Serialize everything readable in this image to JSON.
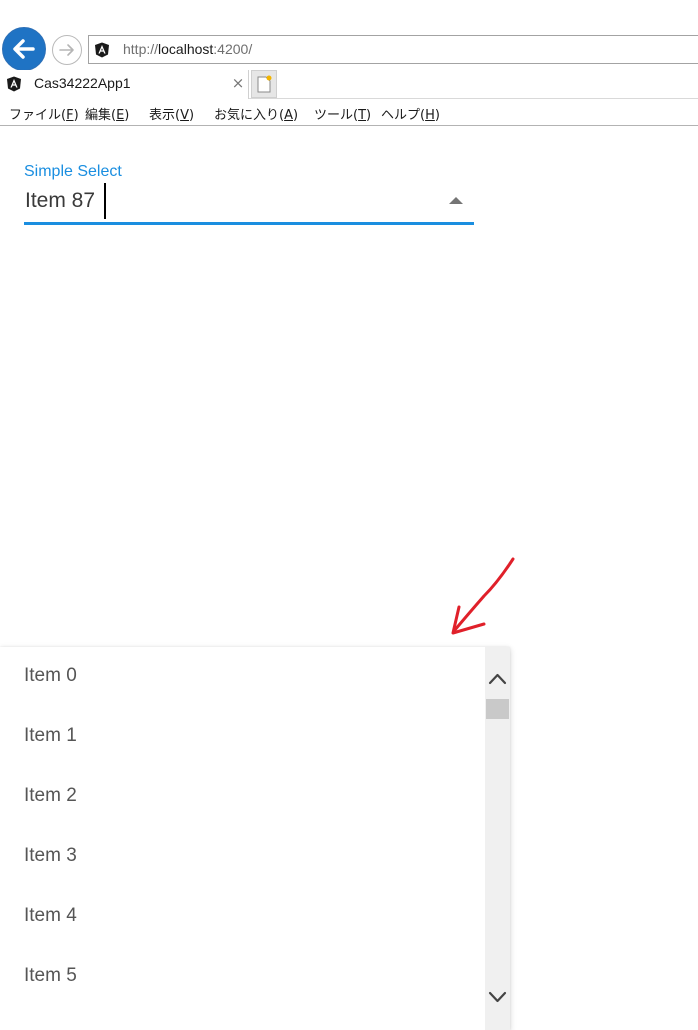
{
  "browser": {
    "url_prefix": "http://",
    "url_host": "localhost",
    "url_suffix": ":4200/",
    "tab_title": "Cas34222App1",
    "tab_close_glyph": "×",
    "site_icon": "angular-logo-icon",
    "menu": [
      {
        "label": "ファイル(",
        "key": "F",
        "end": ")"
      },
      {
        "label": "編集(",
        "key": "E",
        "end": ")"
      },
      {
        "label": "表示(",
        "key": "V",
        "end": ")"
      },
      {
        "label": "お気に入り(",
        "key": "A",
        "end": ")"
      },
      {
        "label": "ツール(",
        "key": "T",
        "end": ")"
      },
      {
        "label": "ヘルプ(",
        "key": "H",
        "end": ")"
      }
    ]
  },
  "select": {
    "label": "Simple Select",
    "value": "Item 87",
    "accent_color": "#1a8ee0"
  },
  "dropdown": {
    "items": [
      "Item 0",
      "Item 1",
      "Item 2",
      "Item 3",
      "Item 4",
      "Item 5"
    ]
  },
  "annotation": {
    "arrow_color": "#e0202a"
  }
}
